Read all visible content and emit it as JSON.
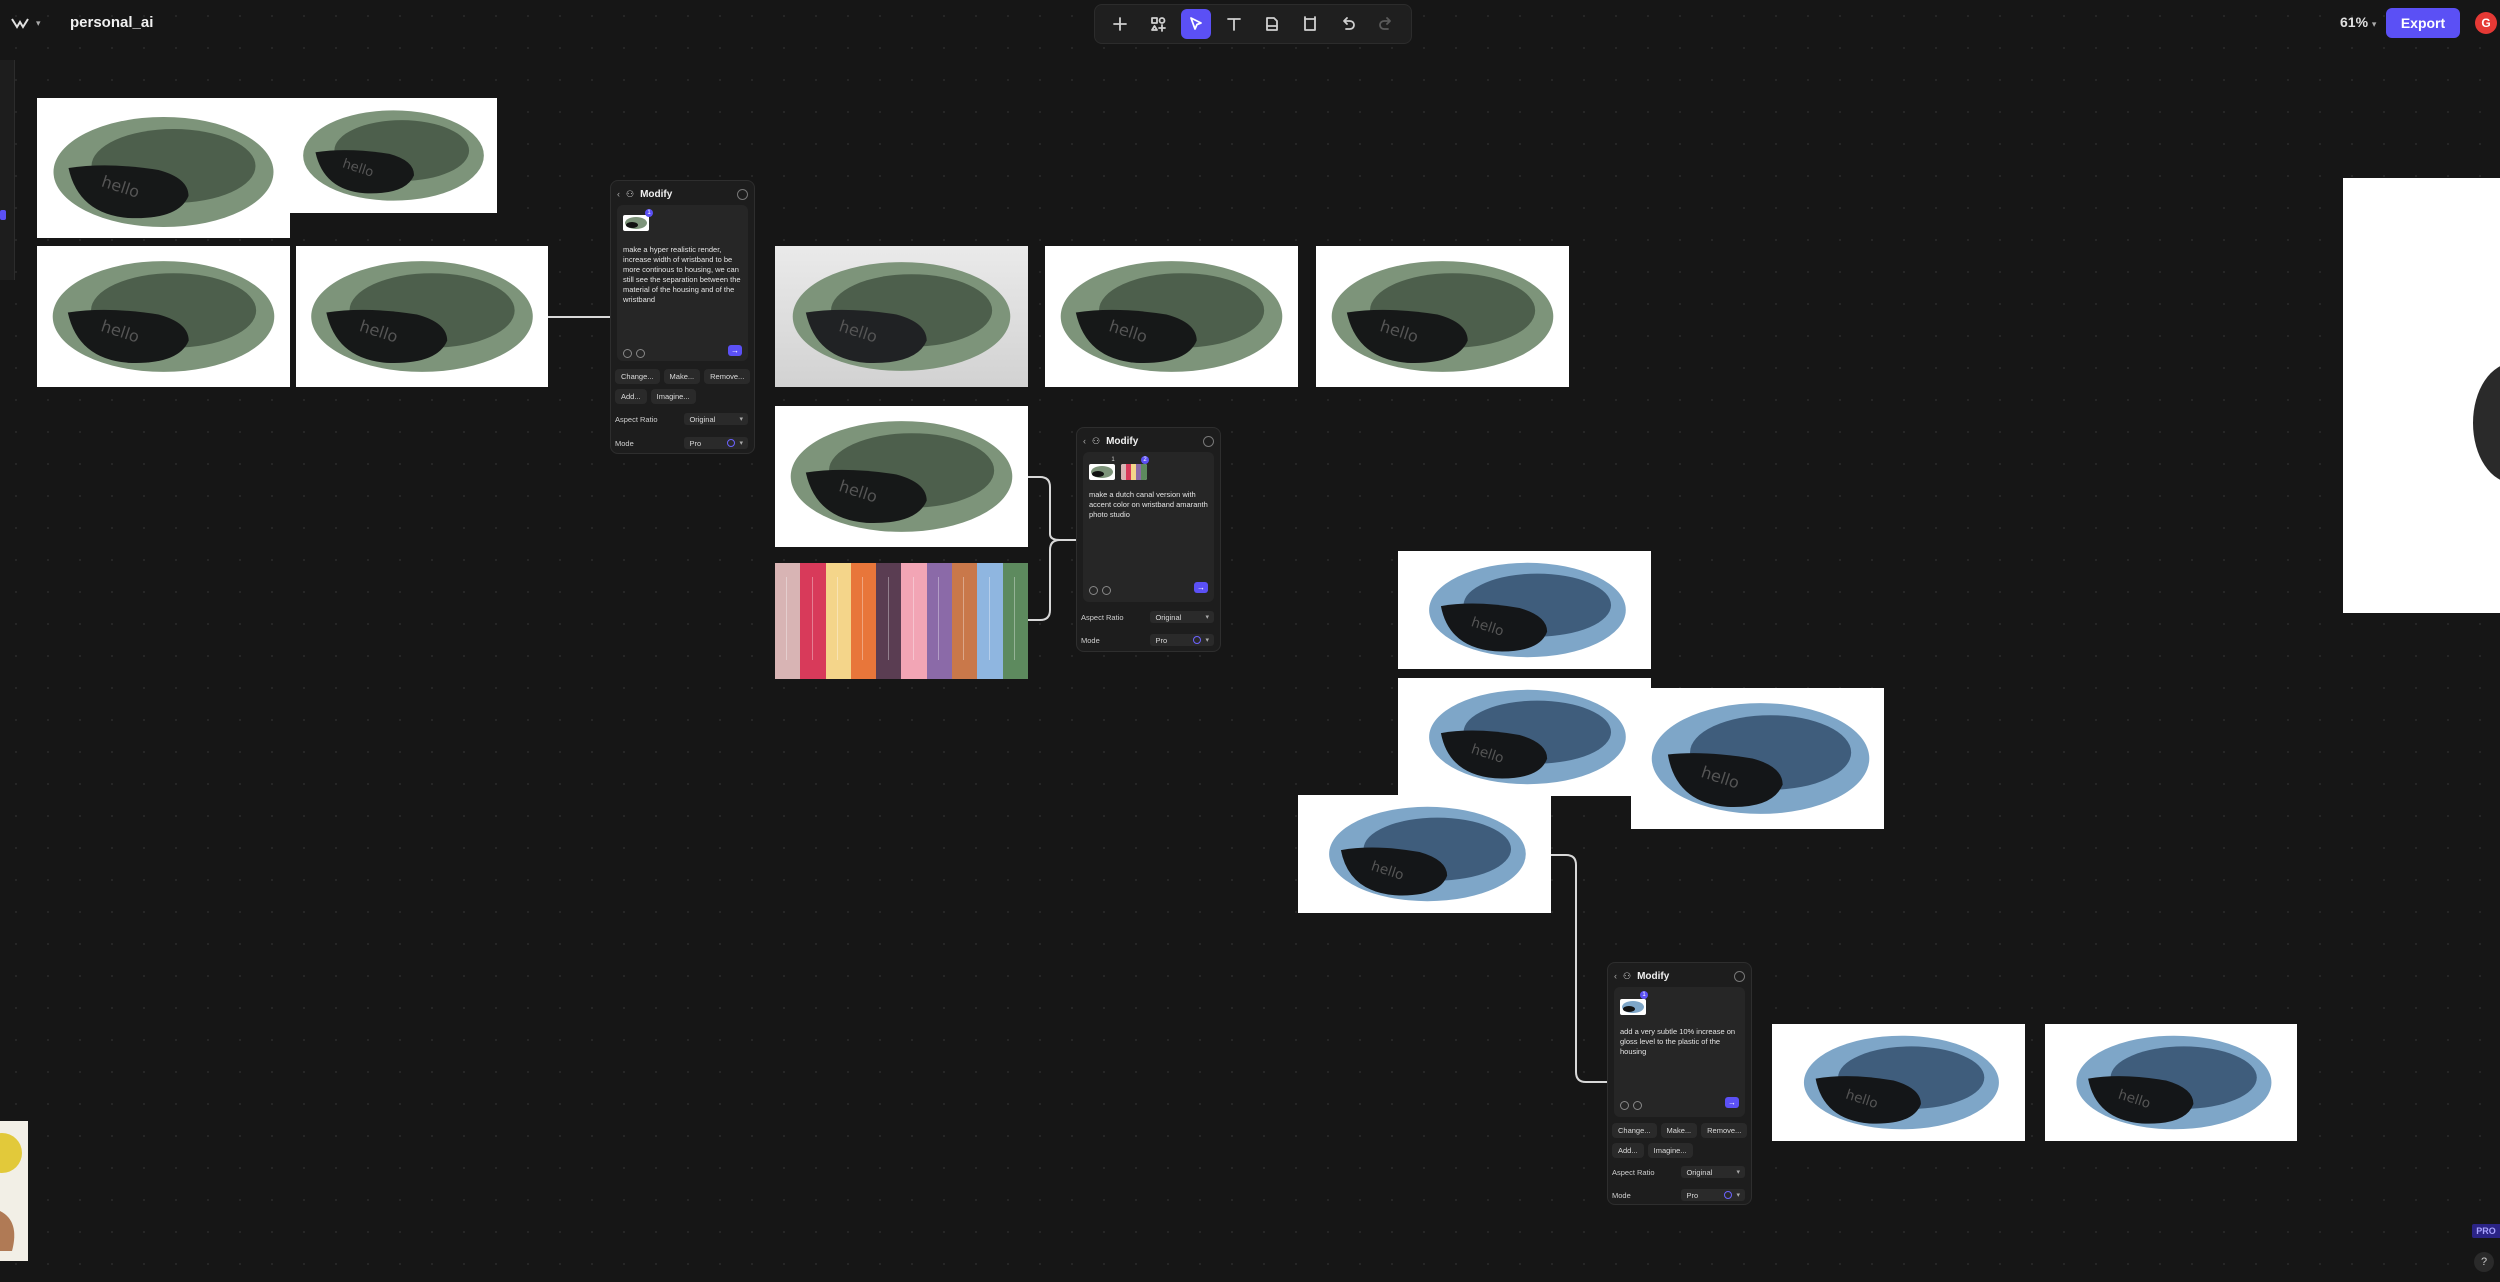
{
  "header": {
    "project_name": "personal_ai",
    "zoom": "61%",
    "export_label": "Export",
    "avatar_initial": "G"
  },
  "toolbar": {
    "tools": [
      {
        "icon": "plus-icon",
        "active": false
      },
      {
        "icon": "shapes-icon",
        "active": false
      },
      {
        "icon": "pointer-icon",
        "active": true
      },
      {
        "icon": "text-icon",
        "active": false
      },
      {
        "icon": "file-icon",
        "active": false
      },
      {
        "icon": "frame-icon",
        "active": false
      },
      {
        "icon": "undo-icon",
        "active": false
      },
      {
        "icon": "redo-icon",
        "active": false
      }
    ]
  },
  "panels": [
    {
      "title": "Modify",
      "prompt": "make a hyper realistic render, increase width of wristband to be more continous to housing, we can still see the separation between the material of the housing and of the wristband",
      "badges": [
        "1"
      ],
      "chips": [
        "Change...",
        "Make...",
        "Remove...",
        "Add...",
        "Imagine..."
      ],
      "aspect_label": "Aspect Ratio",
      "aspect_value": "Original",
      "mode_label": "Mode",
      "mode_value": "Pro"
    },
    {
      "title": "Modify",
      "prompt": "make a dutch canal version with accent color on wristband amaranth photo studio",
      "badges": [
        "1",
        "2"
      ],
      "chips": [],
      "aspect_label": "Aspect Ratio",
      "aspect_value": "Original",
      "mode_label": "Mode",
      "mode_value": "Pro"
    },
    {
      "title": "Modify",
      "prompt": "add a very subtle 10% increase on gloss level to the plastic of the housing",
      "badges": [
        "1"
      ],
      "chips": [
        "Change...",
        "Make...",
        "Remove...",
        "Add...",
        "Imagine..."
      ],
      "aspect_label": "Aspect Ratio",
      "aspect_value": "Original",
      "mode_label": "Mode",
      "mode_value": "Pro"
    }
  ],
  "swatches": [
    "#d8b4b4",
    "#d83a5a",
    "#f4d58a",
    "#e8763a",
    "#5a3d52",
    "#f2a5b5",
    "#8b6aa8",
    "#c9784a",
    "#8fb6e0",
    "#5d8a5e"
  ],
  "colors": {
    "band_green": "#7d947a",
    "band_blue": "#7ea6c8",
    "accent": "#5b50f5"
  },
  "badges": {
    "pro": "PRO",
    "help": "?"
  }
}
